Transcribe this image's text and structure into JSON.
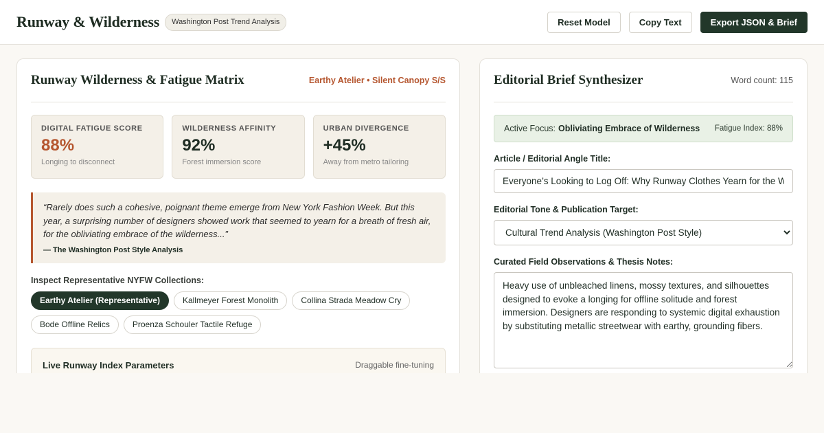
{
  "header": {
    "brand": "Runway & Wilderness",
    "badge": "Washington Post Trend Analysis",
    "actions": {
      "reset": "Reset Model",
      "copy": "Copy Text",
      "export": "Export JSON & Brief"
    }
  },
  "matrix": {
    "title": "Runway Wilderness & Fatigue Matrix",
    "subtitle": "Earthy Atelier • Silent Canopy S/S",
    "metrics": [
      {
        "label": "DIGITAL FATIGUE SCORE",
        "value": "88%",
        "note": "Longing to disconnect"
      },
      {
        "label": "WILDERNESS AFFINITY",
        "value": "92%",
        "note": "Forest immersion score"
      },
      {
        "label": "URBAN DIVERGENCE",
        "value": "+45%",
        "note": "Away from metro tailoring"
      }
    ],
    "accent_color": "#b5562f",
    "quote": {
      "text": "“Rarely does such a cohesive, poignant theme emerge from New York Fashion Week. But this year, a surprising number of designers showed work that seemed to yearn for a breath of fresh air, for the obliviating embrace of the wilderness...”",
      "source": "— The Washington Post Style Analysis"
    },
    "collections_label": "Inspect Representative NYFW Collections:",
    "collections": [
      "Earthy Atelier (Representative)",
      "Kallmeyer Forest Monolith",
      "Collina Strada Meadow Cry",
      "Bode Offline Relics",
      "Proenza Schouler Tactile Refuge"
    ],
    "active_collection": "Earthy Atelier (Representative)",
    "params": {
      "title": "Live Runway Index Parameters",
      "note": "Draggable fine-tuning"
    }
  },
  "brief": {
    "title": "Editorial Brief Synthesizer",
    "word_count": "Word count: 115",
    "focus": {
      "label": "Active Focus:",
      "value": "Obliviating Embrace of Wilderness",
      "index": "Fatigue Index: 88%"
    },
    "title_field": {
      "label": "Article / Editorial Angle Title:",
      "value": "Everyone’s Looking to Log Off: Why Runway Clothes Yearn for the Wild"
    },
    "tone_field": {
      "label": "Editorial Tone & Publication Target:",
      "selected": "Cultural Trend Analysis (Washington Post Style)"
    },
    "notes_field": {
      "label": "Curated Field Observations & Thesis Notes:",
      "value": "Heavy use of unbleached linens, mossy textures, and silhouettes designed to evoke a longing for offline solitude and forest immersion. Designers are responding to systemic digital exhaustion by substituting metallic streetwear with earthy, grounding fibers."
    }
  },
  "colors": {
    "brand_dark": "#22372a",
    "accent": "#b5562f",
    "focus_bg": "#e9f1e6"
  }
}
